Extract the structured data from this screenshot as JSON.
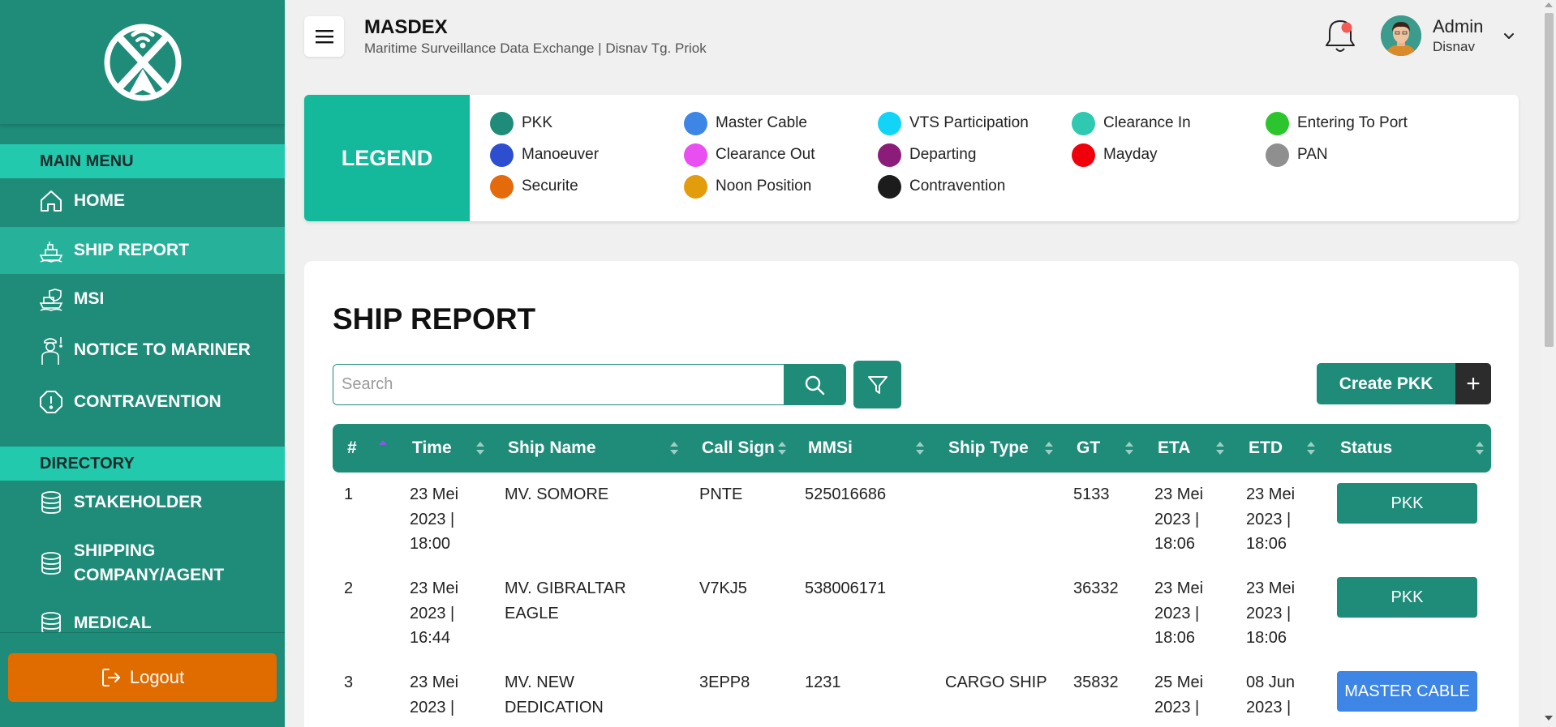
{
  "app": {
    "title": "MASDEX",
    "subtitle": "Maritime Surveillance Data Exchange | Disnav Tg. Priok"
  },
  "user": {
    "name": "Admin",
    "role": "Disnav"
  },
  "sidebar": {
    "main_menu_header": "MAIN MENU",
    "main_menu": [
      {
        "label": "HOME",
        "icon": "home-icon"
      },
      {
        "label": "SHIP REPORT",
        "icon": "ship-icon",
        "active": true
      },
      {
        "label": "MSI",
        "icon": "ship-shield-icon"
      },
      {
        "label": "NOTICE TO MARINER",
        "icon": "mariner-icon"
      },
      {
        "label": "CONTRAVENTION",
        "icon": "alert-octagon-icon"
      }
    ],
    "directory_header": "DIRECTORY",
    "directory": [
      {
        "label": "STAKEHOLDER",
        "icon": "database-icon"
      },
      {
        "label": "SHIPPING COMPANY/AGENT",
        "icon": "database-icon"
      },
      {
        "label": "MEDICAL",
        "icon": "database-icon"
      }
    ],
    "logout_label": "Logout"
  },
  "legend": {
    "title": "LEGEND",
    "items": [
      {
        "label": "PKK",
        "color": "#1e8c79"
      },
      {
        "label": "Master Cable",
        "color": "#3d86e6"
      },
      {
        "label": "VTS Participation",
        "color": "#12d4f7"
      },
      {
        "label": "Clearance In",
        "color": "#2ec9b0"
      },
      {
        "label": "Entering To Port",
        "color": "#2dc52d"
      },
      {
        "label": "Manoeuver",
        "color": "#2d4fcf"
      },
      {
        "label": "Clearance Out",
        "color": "#e84ef0"
      },
      {
        "label": "Departing",
        "color": "#8b1c7a"
      },
      {
        "label": "Mayday",
        "color": "#f0000a"
      },
      {
        "label": "PAN",
        "color": "#8f8f8f"
      },
      {
        "label": "Securite",
        "color": "#e46a0c"
      },
      {
        "label": "Noon Position",
        "color": "#e39c0b"
      },
      {
        "label": "Contravention",
        "color": "#1c1c1c"
      }
    ]
  },
  "report": {
    "title": "SHIP REPORT",
    "search_placeholder": "Search",
    "search_value": "",
    "create_label": "Create PKK",
    "create_plus": "+",
    "columns": [
      "#",
      "Time",
      "Ship Name",
      "Call Sign",
      "MMSi",
      "Ship Type",
      "GT",
      "ETA",
      "ETD",
      "Status"
    ],
    "rows": [
      {
        "no": "1",
        "time": [
          "23 Mei",
          "2023 |",
          "18:00"
        ],
        "ship_name": [
          "MV. SOMORE"
        ],
        "call_sign": "PNTE",
        "mmsi": "525016686",
        "ship_type": "",
        "gt": "5133",
        "eta": [
          "23 Mei",
          "2023 |",
          "18:06"
        ],
        "etd": [
          "23 Mei",
          "2023 |",
          "18:06"
        ],
        "status": "PKK",
        "status_color": "#1e8c79"
      },
      {
        "no": "2",
        "time": [
          "23 Mei",
          "2023 |",
          "16:44"
        ],
        "ship_name": [
          "MV. GIBRALTAR",
          "EAGLE"
        ],
        "call_sign": "V7KJ5",
        "mmsi": "538006171",
        "ship_type": "",
        "gt": "36332",
        "eta": [
          "23 Mei",
          "2023 |",
          "18:06"
        ],
        "etd": [
          "23 Mei",
          "2023 |",
          "18:06"
        ],
        "status": "PKK",
        "status_color": "#1e8c79"
      },
      {
        "no": "3",
        "time": [
          "23 Mei",
          "2023 |"
        ],
        "ship_name": [
          "MV. NEW",
          "DEDICATION"
        ],
        "call_sign": "3EPP8",
        "mmsi": "1231",
        "ship_type": "CARGO SHIP",
        "gt": "35832",
        "eta": [
          "25 Mei",
          "2023 |"
        ],
        "etd": [
          "08 Jun",
          "2023 |"
        ],
        "status": "MASTER CABLE",
        "status_color": "#3d86e6"
      }
    ]
  }
}
